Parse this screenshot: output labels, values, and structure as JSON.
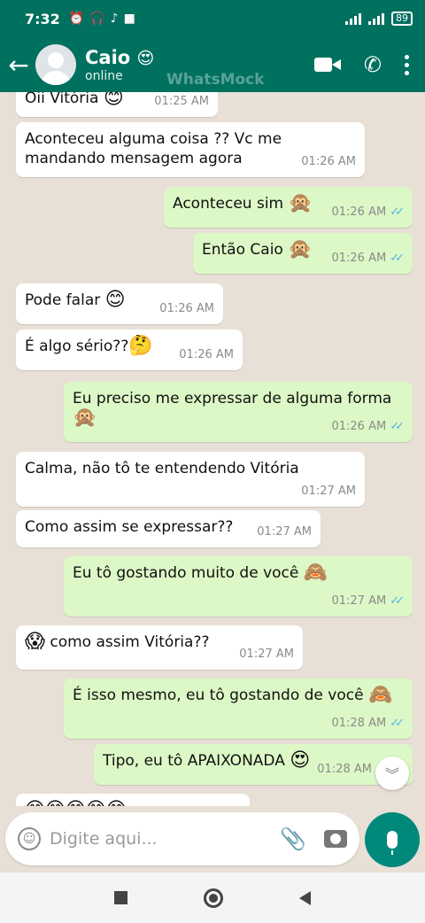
{
  "status_bar": {
    "time": "7:32",
    "battery": "89"
  },
  "header": {
    "contact_name": "Caio",
    "name_emoji": "😍",
    "status": "online",
    "watermark": "WhatsMock"
  },
  "messages": [
    {
      "dir": "in",
      "text": "Oii Vitória",
      "emoji": "😊",
      "time": "01:25 AM"
    },
    {
      "dir": "in",
      "text": "Aconteceu alguma coisa ?? Vc me mandando mensagem agora",
      "emoji": "",
      "time": "01:26 AM"
    },
    {
      "dir": "out",
      "text": "Aconteceu sim",
      "emoji": "🙊",
      "time": "01:26 AM"
    },
    {
      "dir": "out",
      "text": "Então Caio",
      "emoji": "🙊",
      "time": "01:26 AM"
    },
    {
      "dir": "in",
      "text": "Pode falar",
      "emoji": "😊",
      "time": "01:26 AM"
    },
    {
      "dir": "in",
      "text": "É algo sério??",
      "emoji": "🤔",
      "time": "01:26 AM"
    },
    {
      "dir": "out",
      "text": "Eu preciso me expressar de alguma forma",
      "emoji": "🙊",
      "time": "01:26 AM"
    },
    {
      "dir": "in",
      "text": "Calma, não tô te entendendo Vitória",
      "emoji": "",
      "time": "01:27 AM"
    },
    {
      "dir": "in",
      "text": "Como assim se expressar??",
      "emoji": "",
      "time": "01:27 AM"
    },
    {
      "dir": "out",
      "text": "Eu tô gostando muito de você",
      "emoji": "🙈",
      "time": "01:27 AM"
    },
    {
      "dir": "in",
      "text": "como assim Vitória??",
      "emoji": "😱",
      "time": "01:27 AM"
    },
    {
      "dir": "out",
      "text": "É isso mesmo, eu tô gostando de você",
      "emoji": "🙈",
      "time": "01:28 AM"
    },
    {
      "dir": "out",
      "text": "Tipo, eu tô APAIXONADA",
      "emoji": "😍",
      "time": "01:28 AM"
    },
    {
      "dir": "in",
      "text": "",
      "emoji": "😊😊😊😊😊",
      "time": ""
    }
  ],
  "input": {
    "placeholder": "Digite aqui..."
  },
  "icons": {
    "back": "arrow-left-icon",
    "video": "video-call-icon",
    "phone": "phone-icon",
    "menu": "more-vertical-icon",
    "emoji": "emoji-icon",
    "attach": "paperclip-icon",
    "camera": "camera-icon",
    "mic": "mic-icon",
    "scroll": "chevron-double-down-icon",
    "read": "double-check-icon"
  },
  "colors": {
    "header": "#00705f",
    "outgoing": "#dcf8c6",
    "incoming": "#ffffff",
    "ticks": "#4fb5e6",
    "mic_button": "#00897b"
  }
}
